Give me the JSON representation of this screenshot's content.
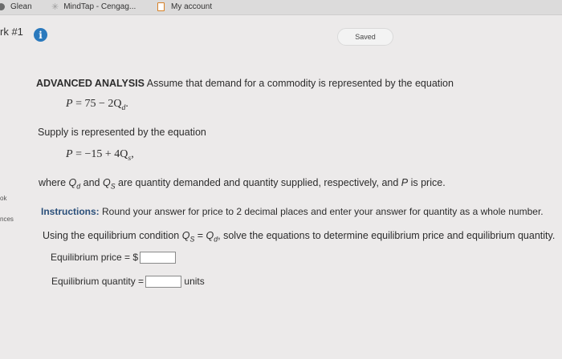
{
  "bookmarks": [
    {
      "label": "Glean",
      "icon": "glean-icon"
    },
    {
      "label": "MindTap - Cengag...",
      "icon": "mindtap-icon"
    },
    {
      "label": "My account",
      "icon": "book-icon"
    }
  ],
  "header": {
    "title_partial": "rk #1",
    "info_icon_glyph": "i",
    "saved_label": "Saved"
  },
  "sidebar_partial": {
    "item1": "ok",
    "item2": "nces"
  },
  "question": {
    "heading": "ADVANCED ANALYSIS",
    "intro": "Assume that demand for a commodity is represented by the equation",
    "demand_eq": {
      "lhs": "P",
      "rhs": " = 75 − 2Q",
      "sub": "d",
      "end": "."
    },
    "supply_intro": "Supply is represented by the equation",
    "supply_eq": {
      "lhs": "P",
      "rhs": " = −15 + 4Q",
      "sub": "s",
      "end": ","
    },
    "where_text": {
      "p1": "where ",
      "qd": "Q",
      "qd_sub": "d",
      "p2": " and ",
      "qs": "Q",
      "qs_sub": "S",
      "p3": " are quantity demanded and quantity supplied, respectively, and ",
      "p": "P",
      "p4": " is price."
    },
    "instructions_label": "Instructions:",
    "instructions_text": " Round your answer for price to 2 decimal places and enter your answer for quantity as a whole number.",
    "using_text": {
      "p1": "Using the equilibrium condition ",
      "qs": "Q",
      "qs_sub": "S",
      "eq": " = ",
      "qd": "Q",
      "qd_sub": "d",
      "p2": ", solve the equations to determine equilibrium price and equilibrium quantity."
    },
    "price_label": "Equilibrium price = $",
    "price_value": "",
    "quantity_label": "Equilibrium quantity =",
    "quantity_value": "",
    "quantity_units": "units"
  }
}
